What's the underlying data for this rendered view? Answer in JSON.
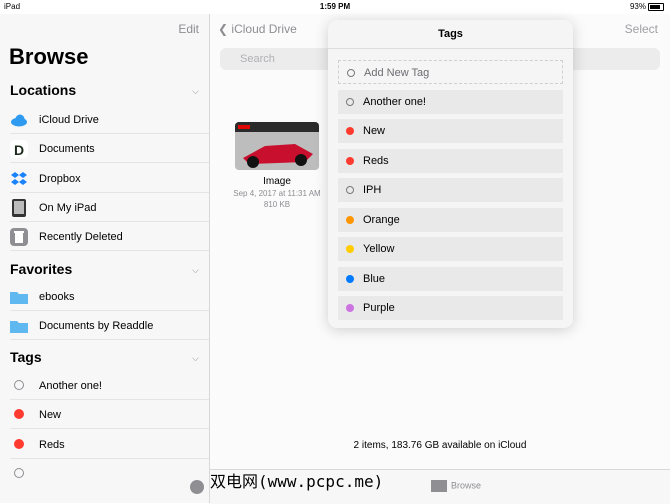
{
  "statusbar": {
    "left": "iPad ",
    "time": "1:59 PM",
    "right": "93%"
  },
  "sidebar": {
    "edit": "Edit",
    "title": "Browse",
    "locations_title": "Locations",
    "locations": [
      {
        "label": "iCloud Drive",
        "icon": "cloud-icon"
      },
      {
        "label": "Documents",
        "icon": "documents-app-icon"
      },
      {
        "label": "Dropbox",
        "icon": "dropbox-icon"
      },
      {
        "label": "On My iPad",
        "icon": "ipad-icon"
      },
      {
        "label": "Recently Deleted",
        "icon": "trash-icon"
      }
    ],
    "favorites_title": "Favorites",
    "favorites": [
      {
        "label": "ebooks",
        "icon": "folder-icon"
      },
      {
        "label": "Documents by Readdle",
        "icon": "folder-icon"
      }
    ],
    "tags_title": "Tags",
    "tags": [
      {
        "label": "Another one!",
        "color": "none"
      },
      {
        "label": "New",
        "color": "#ff3b30"
      },
      {
        "label": "Reds",
        "color": "#ff3b30"
      }
    ]
  },
  "main": {
    "back_label": "iCloud Drive",
    "select_label": "Select",
    "search_placeholder": "Search",
    "file": {
      "name": "Image",
      "date": "Sep 4, 2017 at 11:31 AM",
      "size": "810 KB"
    },
    "footer": "2 items, 183.76 GB available on iCloud",
    "tabbar": {
      "browse": "Browse"
    }
  },
  "popover": {
    "title": "Tags",
    "add_label": "Add New Tag",
    "tags": [
      {
        "label": "Another one!",
        "color": "none"
      },
      {
        "label": "New",
        "color": "#ff3b30"
      },
      {
        "label": "Reds",
        "color": "#ff3b30"
      },
      {
        "label": "IPH",
        "color": "none"
      },
      {
        "label": "Orange",
        "color": "#ff9500"
      },
      {
        "label": "Yellow",
        "color": "#ffcc00"
      },
      {
        "label": "Blue",
        "color": "#007aff"
      },
      {
        "label": "Purple",
        "color": "#cc73e1"
      }
    ]
  },
  "watermark": "双电网(www.pcpc.me)"
}
